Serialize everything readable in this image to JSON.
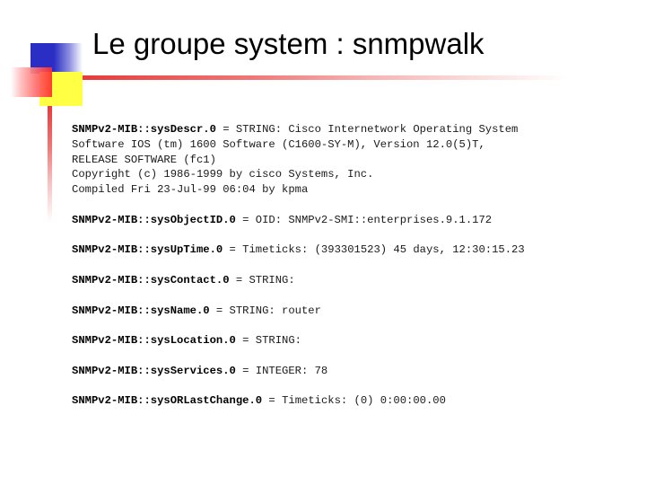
{
  "slide": {
    "title": "Le groupe system : snmpwalk",
    "entries": [
      {
        "oid": "SNMPv2-MIB::sysDescr.0",
        "assign": " = ",
        "value_lines": [
          "STRING: Cisco Internetwork Operating System",
          "Software IOS (tm) 1600 Software (C1600-SY-M), Version 12.0(5)T,",
          "RELEASE SOFTWARE (fc1)",
          "Copyright (c) 1986-1999 by cisco Systems, Inc.",
          "Compiled Fri 23-Jul-99 06:04 by kpma"
        ]
      },
      {
        "oid": "SNMPv2-MIB::sysObjectID.0",
        "assign": " = ",
        "value_lines": [
          "OID: SNMPv2-SMI::enterprises.9.1.172"
        ]
      },
      {
        "oid": "SNMPv2-MIB::sysUpTime.0",
        "assign": " = ",
        "value_lines": [
          "Timeticks: (393301523) 45 days, 12:30:15.23"
        ]
      },
      {
        "oid": "SNMPv2-MIB::sysContact.0",
        "assign": " = ",
        "value_lines": [
          "STRING:"
        ]
      },
      {
        "oid": "SNMPv2-MIB::sysName.0",
        "assign": " = ",
        "value_lines": [
          "STRING: router"
        ]
      },
      {
        "oid": "SNMPv2-MIB::sysLocation.0",
        "assign": " = ",
        "value_lines": [
          "STRING:"
        ]
      },
      {
        "oid": "SNMPv2-MIB::sysServices.0",
        "assign": " = ",
        "value_lines": [
          "INTEGER: 78"
        ]
      },
      {
        "oid": "SNMPv2-MIB::sysORLastChange.0",
        "assign": " = ",
        "value_lines": [
          "Timeticks: (0) 0:00:00.00"
        ]
      }
    ]
  },
  "colors": {
    "accent_blue": "#2a2ec4",
    "accent_yellow": "#ffff44",
    "accent_red": "#e83a3a"
  }
}
